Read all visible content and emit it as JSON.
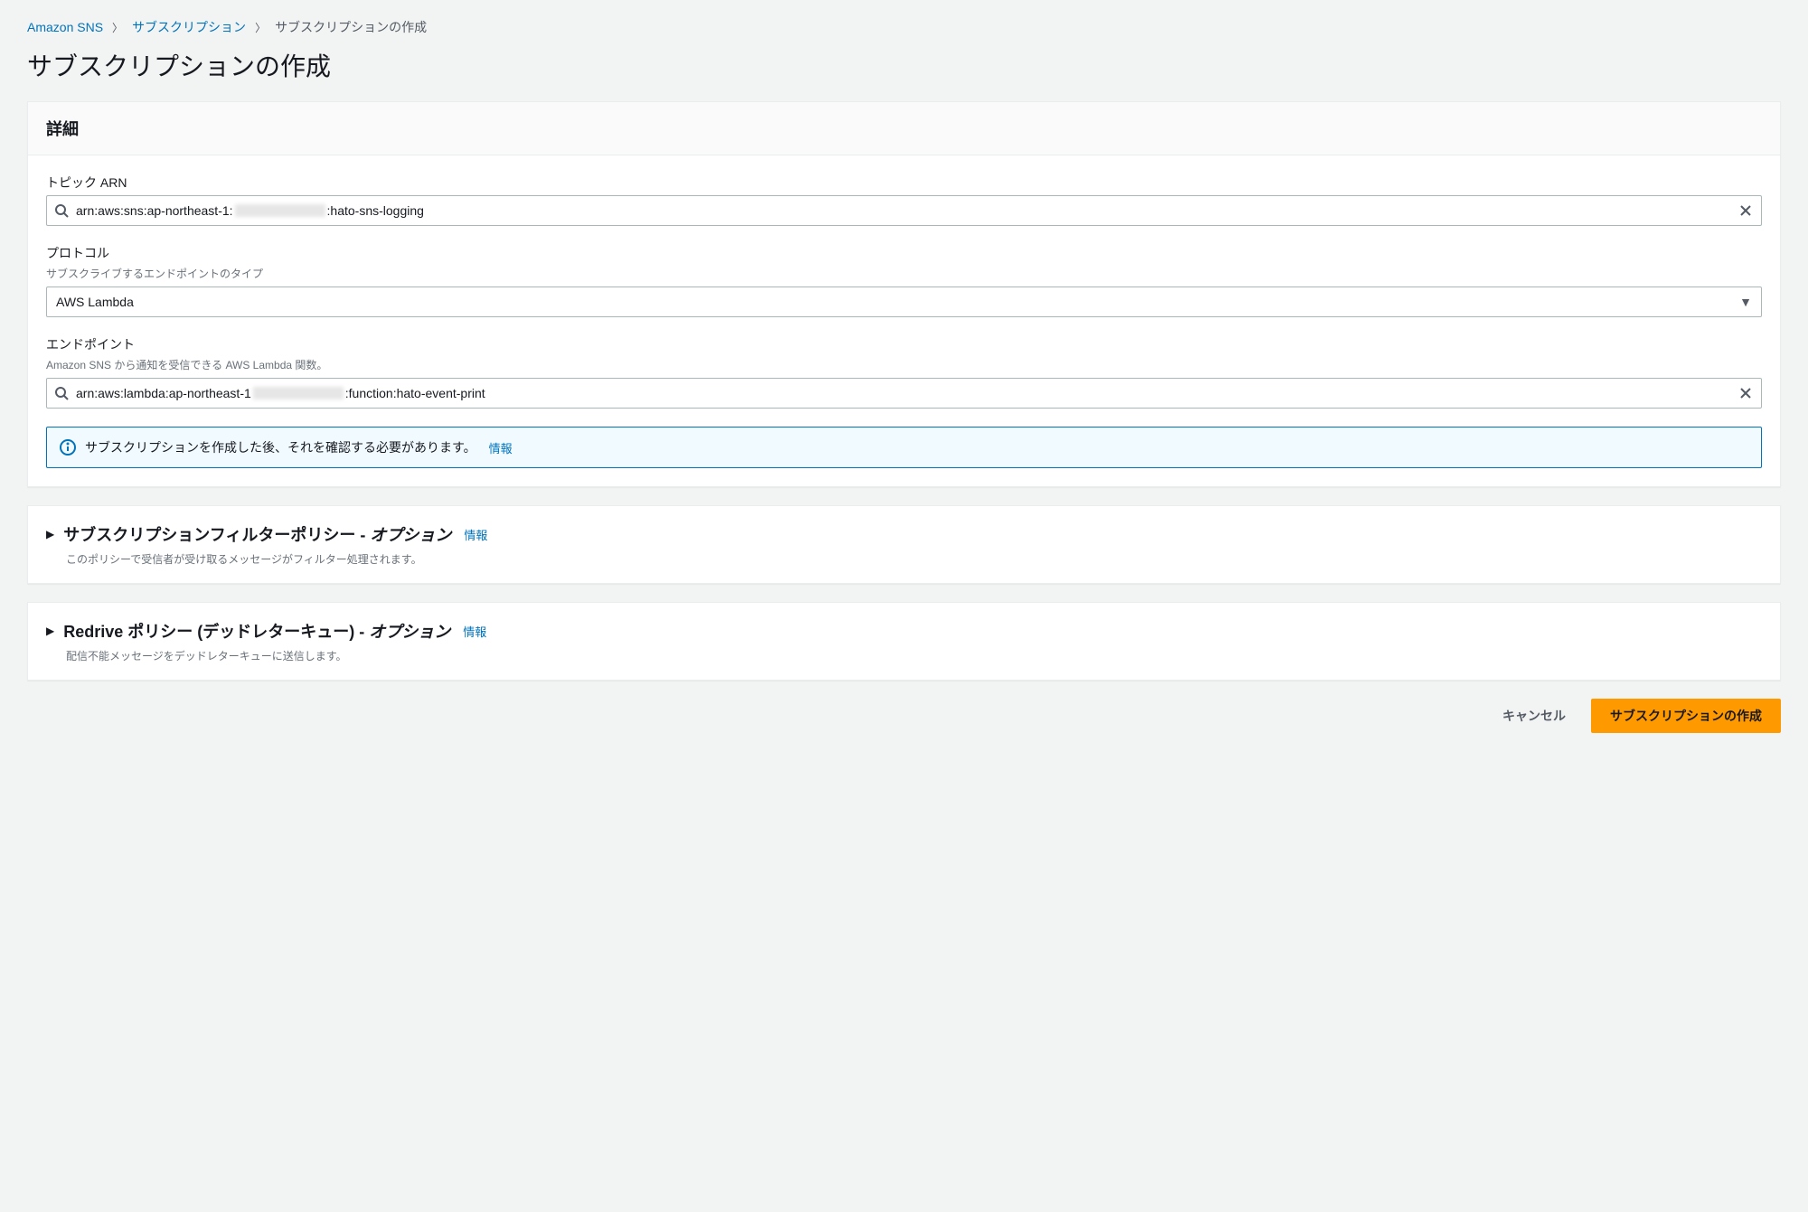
{
  "breadcrumb": {
    "items": [
      {
        "label": "Amazon SNS",
        "link": true
      },
      {
        "label": "サブスクリプション",
        "link": true
      },
      {
        "label": "サブスクリプションの作成",
        "link": false
      }
    ]
  },
  "page": {
    "title": "サブスクリプションの作成"
  },
  "details": {
    "header": "詳細",
    "topic_arn": {
      "label": "トピック ARN",
      "value_prefix": "arn:aws:sns:ap-northeast-1:",
      "value_suffix": ":hato-sns-logging"
    },
    "protocol": {
      "label": "プロトコル",
      "hint": "サブスクライブするエンドポイントのタイプ",
      "value": "AWS Lambda"
    },
    "endpoint": {
      "label": "エンドポイント",
      "hint": "Amazon SNS から通知を受信できる AWS Lambda 関数。",
      "value_prefix": "arn:aws:lambda:ap-northeast-1",
      "value_suffix": ":function:hato-event-print"
    },
    "info_alert": {
      "text": "サブスクリプションを作成した後、それを確認する必要があります。",
      "info_link": "情報"
    }
  },
  "filter_policy": {
    "title_main": "サブスクリプションフィルターポリシー - ",
    "title_optional": "オプション",
    "info_link": "情報",
    "description": "このポリシーで受信者が受け取るメッセージがフィルター処理されます。"
  },
  "redrive_policy": {
    "title_main": "Redrive ポリシー (デッドレターキュー) - ",
    "title_optional": "オプション",
    "info_link": "情報",
    "description": "配信不能メッセージをデッドレターキューに送信します。"
  },
  "actions": {
    "cancel": "キャンセル",
    "create": "サブスクリプションの作成"
  }
}
